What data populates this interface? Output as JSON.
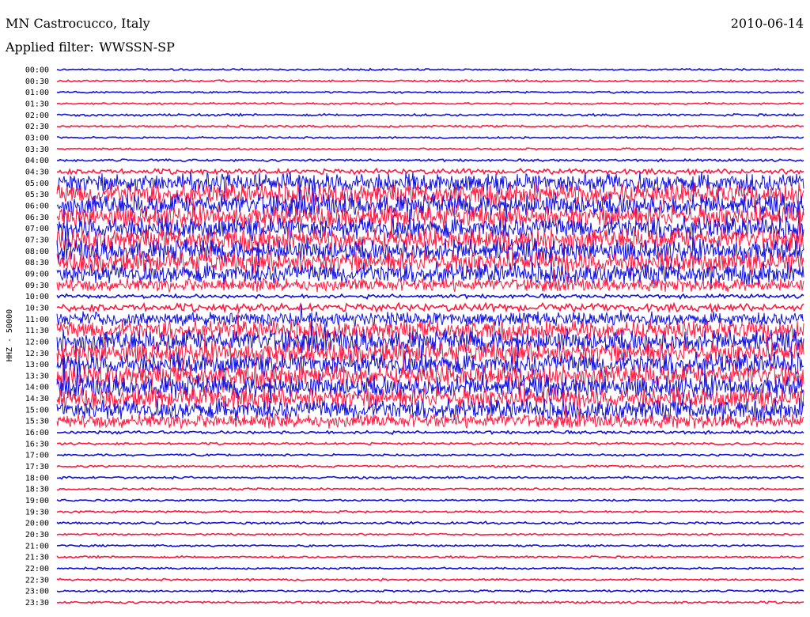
{
  "header": {
    "station": "MN Castrocucco, Italy",
    "date": "2010-06-14",
    "filter_label": "Applied filter:",
    "filter_value": "WWSSN-SP"
  },
  "chart_data": {
    "type": "line",
    "title": "MN Castrocucco, Italy",
    "date": "2010-06-14",
    "filter": "WWSSN-SP",
    "ylabel": "HHZ - 50000",
    "trace_colors": [
      "#1010e0",
      "#ff1a40"
    ],
    "background": "#ffffff",
    "rows": [
      {
        "label": "00:00",
        "activity": 0.02
      },
      {
        "label": "00:30",
        "activity": 0.03
      },
      {
        "label": "01:00",
        "activity": 0.02
      },
      {
        "label": "01:30",
        "activity": 0.02
      },
      {
        "label": "02:00",
        "activity": 0.04
      },
      {
        "label": "02:30",
        "activity": 0.03
      },
      {
        "label": "03:00",
        "activity": 0.02
      },
      {
        "label": "03:30",
        "activity": 0.03
      },
      {
        "label": "04:00",
        "activity": 0.05
      },
      {
        "label": "04:30",
        "activity": 0.18
      },
      {
        "label": "05:00",
        "activity": 0.9
      },
      {
        "label": "05:30",
        "activity": 0.95
      },
      {
        "label": "06:00",
        "activity": 1.0
      },
      {
        "label": "06:30",
        "activity": 1.0
      },
      {
        "label": "07:00",
        "activity": 1.0
      },
      {
        "label": "07:30",
        "activity": 1.0
      },
      {
        "label": "08:00",
        "activity": 1.0
      },
      {
        "label": "08:30",
        "activity": 1.0
      },
      {
        "label": "09:00",
        "activity": 0.9
      },
      {
        "label": "09:30",
        "activity": 0.55
      },
      {
        "label": "10:00",
        "activity": 0.12
      },
      {
        "label": "10:30",
        "activity": 0.3
      },
      {
        "label": "11:00",
        "activity": 0.6
      },
      {
        "label": "11:30",
        "activity": 0.85
      },
      {
        "label": "12:00",
        "activity": 1.0
      },
      {
        "label": "12:30",
        "activity": 1.0
      },
      {
        "label": "13:00",
        "activity": 1.0
      },
      {
        "label": "13:30",
        "activity": 1.0
      },
      {
        "label": "14:00",
        "activity": 1.0
      },
      {
        "label": "14:30",
        "activity": 0.95
      },
      {
        "label": "15:00",
        "activity": 0.9
      },
      {
        "label": "15:30",
        "activity": 0.6
      },
      {
        "label": "16:00",
        "activity": 0.08
      },
      {
        "label": "16:30",
        "activity": 0.04
      },
      {
        "label": "17:00",
        "activity": 0.03
      },
      {
        "label": "17:30",
        "activity": 0.03
      },
      {
        "label": "18:00",
        "activity": 0.04
      },
      {
        "label": "18:30",
        "activity": 0.03
      },
      {
        "label": "19:00",
        "activity": 0.02
      },
      {
        "label": "19:30",
        "activity": 0.03
      },
      {
        "label": "20:00",
        "activity": 0.04
      },
      {
        "label": "20:30",
        "activity": 0.02
      },
      {
        "label": "21:00",
        "activity": 0.03
      },
      {
        "label": "21:30",
        "activity": 0.03
      },
      {
        "label": "22:00",
        "activity": 0.02
      },
      {
        "label": "22:30",
        "activity": 0.03
      },
      {
        "label": "23:00",
        "activity": 0.03
      },
      {
        "label": "23:30",
        "activity": 0.04
      }
    ]
  }
}
